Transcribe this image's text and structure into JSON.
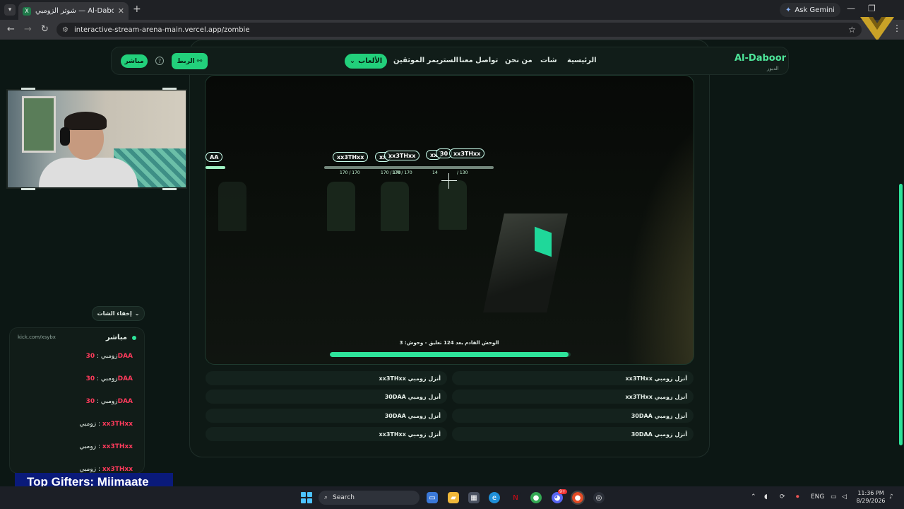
{
  "browser": {
    "tab_title": "شوتر الزومبي — Al-Daboor",
    "tab_icon": "X",
    "url": "interactive-stream-arena-main.vercel.app/zombie",
    "gemini_label": "Ask Gemini"
  },
  "site": {
    "brand": "Al-Daboor",
    "brand_sub": "الدبور",
    "nav": {
      "home": "الرئيسية",
      "chat": "شات",
      "about": "من نحن",
      "contact": "تواصل معنا",
      "verified": "الستريمر الموثقين",
      "games": "الألعاب"
    },
    "link_button": "الربط",
    "live_button": "مباشر",
    "help": "?"
  },
  "game": {
    "nametags": [
      "AA",
      "xx3THxx",
      "xx",
      "xx3THxx",
      "xx",
      "30",
      "xx3THxx"
    ],
    "hp_labels": [
      "170 / 170",
      "170 / 170",
      "170 / 170",
      "14",
      "/ 130"
    ],
    "wave_text": "الوحش القادم بعد 124 تعليق - وحوش: 3",
    "wave_progress": 0.99
  },
  "events": {
    "left": [
      "xx3THxx أنزل زومبي",
      "30DAA أنزل زومبي",
      "30DAA أنزل زومبي",
      "xx3THxx أنزل زومبي"
    ],
    "right": [
      "xx3THxx أنزل زومبي",
      "xx3THxx أنزل زومبي",
      "30DAA أنزل زومبي",
      "30DAA أنزل زومبي"
    ]
  },
  "chat": {
    "hide_label": "إخفاء الشات",
    "live_label": "مباشر",
    "channel_url": "kick.com/xsybx",
    "messages": [
      {
        "user": "30DAA",
        "text": "زومبي"
      },
      {
        "user": "30DAA",
        "text": "زومبي"
      },
      {
        "user": "30DAA",
        "text": "زومبي"
      },
      {
        "user": "xx3THxx",
        "text": "زومبي"
      },
      {
        "user": "xx3THxx",
        "text": "زومبي"
      },
      {
        "user": "xx3THxx",
        "text": "زومبي"
      }
    ]
  },
  "overlay": {
    "top_gifters": "Top Gifters: Miimaate"
  },
  "taskbar": {
    "search": "Search",
    "lang": "ENG",
    "time": "11:36 PM",
    "date": "8/29/2026",
    "discord_badge": "9+"
  },
  "colors": {
    "accent": "#22d07b",
    "chat_user": "#ff3b5c",
    "gifters_bg": "#0a1a7a"
  }
}
